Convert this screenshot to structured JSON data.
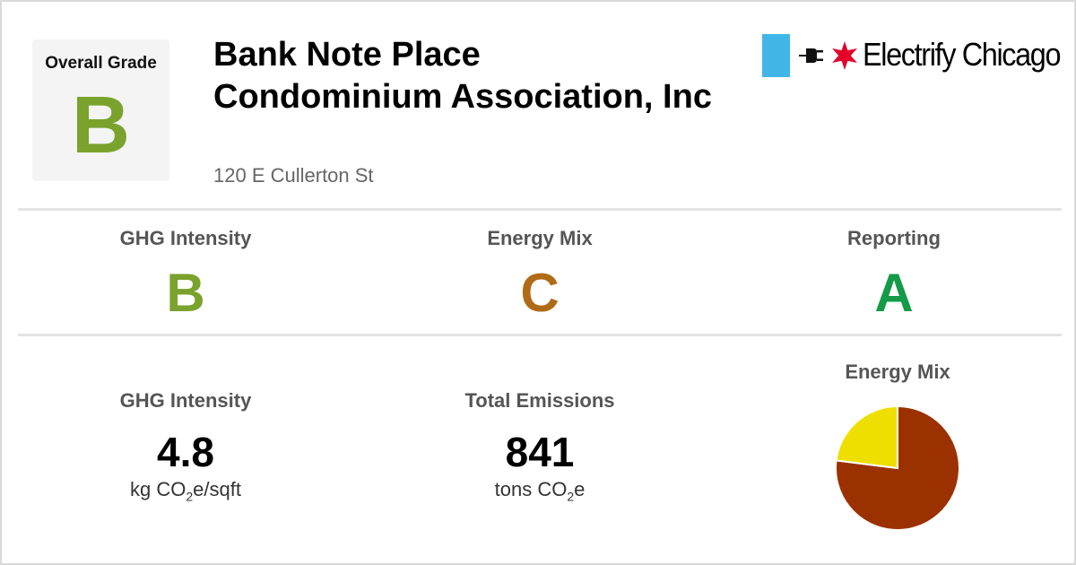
{
  "overall": {
    "label": "Overall Grade",
    "grade": "B",
    "color": "#7aa22d"
  },
  "building": {
    "name": "Bank Note Place Condominium Association, Inc",
    "address": "120 E Cullerton St"
  },
  "brand": {
    "name": "Electrify Chicago",
    "icons": [
      "plug-icon",
      "red-star-icon"
    ],
    "bar_color": "#41b6e6",
    "star_color": "#e4002b"
  },
  "grades": [
    {
      "label": "GHG Intensity",
      "grade": "B",
      "color": "#7aa22d"
    },
    {
      "label": "Energy Mix",
      "grade": "C",
      "color": "#b06b17"
    },
    {
      "label": "Reporting",
      "grade": "A",
      "color": "#149a48"
    }
  ],
  "stats": [
    {
      "label": "GHG Intensity",
      "value": "4.8",
      "unit_prefix": "kg CO",
      "unit_sub": "2",
      "unit_suffix": "e/sqft"
    },
    {
      "label": "Total Emissions",
      "value": "841",
      "unit_prefix": "tons CO",
      "unit_sub": "2",
      "unit_suffix": "e"
    }
  ],
  "chart_data": {
    "type": "pie",
    "title": "Energy Mix",
    "slices": [
      {
        "value": 77,
        "color": "#9c3100"
      },
      {
        "value": 23,
        "color": "#eedf00"
      }
    ]
  }
}
